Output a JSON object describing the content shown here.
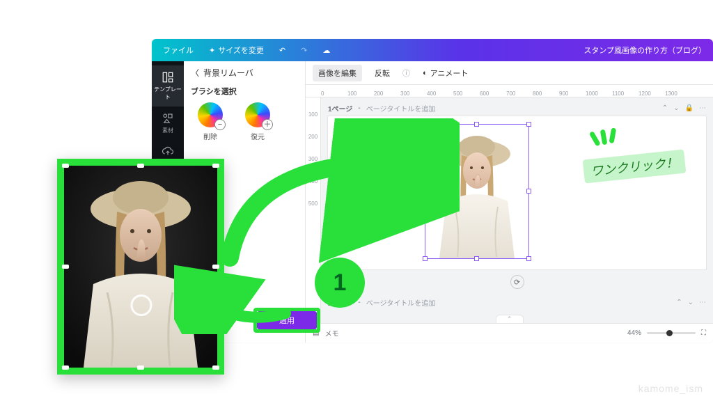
{
  "topbar": {
    "file": "ファイル",
    "resize": "サイズを変更",
    "doc_title": "スタンプ風画像の作り方（ブログ）"
  },
  "rail": {
    "templates": "テンプレート",
    "elements": "素材",
    "uploads": "アップロード"
  },
  "panel": {
    "title": "背景リムーバ",
    "brush_label": "ブラシを選択",
    "erase": "削除",
    "restore": "復元"
  },
  "toolbar": {
    "edit_image": "画像を編集",
    "flip": "反転",
    "animate": "アニメート"
  },
  "ruler_h": [
    "0",
    "100",
    "200",
    "300",
    "400",
    "500",
    "600",
    "700",
    "800",
    "900",
    "1000",
    "1100",
    "1200",
    "1300"
  ],
  "ruler_v": [
    "100",
    "200",
    "300",
    "400",
    "500"
  ],
  "pages": {
    "p1_prefix": "1ページ",
    "p2_prefix": "2ページ",
    "title_hint": "ページタイトルを追加"
  },
  "bottom": {
    "memo": "メモ",
    "zoom": "44%"
  },
  "annotation": {
    "step": "1",
    "apply": "適用",
    "speech": "ワンクリック！"
  },
  "watermark": "kamome_ism"
}
